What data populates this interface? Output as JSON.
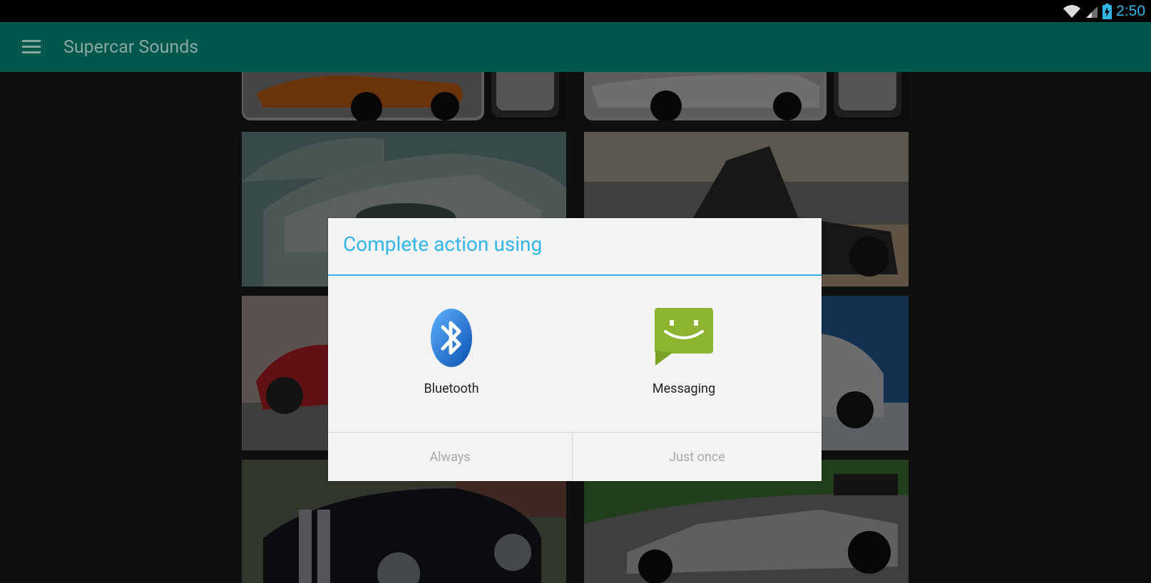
{
  "status_bar": {
    "time": "2:50",
    "icons": [
      "wifi-icon",
      "signal-icon",
      "battery-charging-icon"
    ]
  },
  "app_bar": {
    "title": "Supercar Sounds",
    "menu_icon": "hamburger-menu-icon"
  },
  "colors": {
    "app_bar": "#00574b",
    "accent": "#33b5e5",
    "dialog_bg": "#f3f3f3"
  },
  "dialog": {
    "title": "Complete action using",
    "options": [
      {
        "label": "Bluetooth",
        "icon": "bluetooth-icon"
      },
      {
        "label": "Messaging",
        "icon": "messaging-icon"
      }
    ],
    "buttons": {
      "always": "Always",
      "just_once": "Just once"
    }
  }
}
